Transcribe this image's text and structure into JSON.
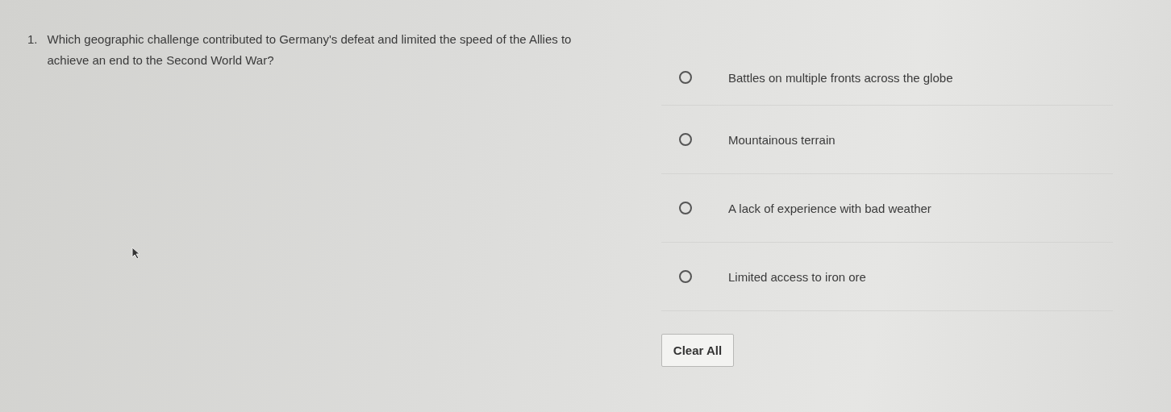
{
  "question": {
    "number": "1.",
    "text": "Which geographic challenge contributed to Germany's defeat and limited the speed of the Allies to achieve an end to the Second World War?"
  },
  "options": [
    {
      "label": "Battles on multiple fronts across the globe",
      "selected": false
    },
    {
      "label": "Mountainous terrain",
      "selected": false
    },
    {
      "label": "A lack of experience with bad weather",
      "selected": false
    },
    {
      "label": "Limited access to iron ore",
      "selected": false
    }
  ],
  "clear_button": "Clear All"
}
